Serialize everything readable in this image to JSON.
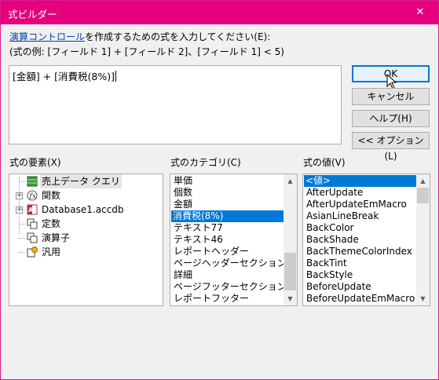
{
  "window": {
    "title": "式ビルダー",
    "close_glyph": "✕",
    "accent_color": "#e6007e"
  },
  "instruction": {
    "link_text": "演算コントロール",
    "rest_text": "を作成するための式を入力してください(E):",
    "example_text": "(式の例: [フィールド 1] + [フィールド 2]、[フィールド 1] < 5)"
  },
  "expression": {
    "value": "[金額] + [消費税(8%)]"
  },
  "buttons": {
    "ok": "OK",
    "cancel": "キャンセル",
    "help": "ヘルプ(H)",
    "options": "<< オプション(L)"
  },
  "elements_panel": {
    "label": "式の要素(X)",
    "items": [
      {
        "label": "売上データ クエリ",
        "icon": "query-icon",
        "expandable": false,
        "selected": true
      },
      {
        "label": "関数",
        "icon": "function-icon",
        "expandable": true,
        "selected": false
      },
      {
        "label": "Database1.accdb",
        "icon": "database-icon",
        "expandable": true,
        "selected": false
      },
      {
        "label": "定数",
        "icon": "constants-icon",
        "expandable": false,
        "selected": false
      },
      {
        "label": "演算子",
        "icon": "operators-icon",
        "expandable": false,
        "selected": false
      },
      {
        "label": "汎用",
        "icon": "common-expressions-icon",
        "expandable": false,
        "selected": false
      }
    ]
  },
  "categories_panel": {
    "label": "式のカテゴリ(C)",
    "items": [
      "単価",
      "個数",
      "金額",
      "消費税(8%)",
      "テキスト77",
      "テキスト46",
      "レポートヘッダー",
      "ページヘッダーセクション",
      "詳細",
      "ページフッターセクション",
      "レポートフッター"
    ],
    "selected_index": 3
  },
  "values_panel": {
    "label": "式の値(V)",
    "items": [
      "<値>",
      "AfterUpdate",
      "AfterUpdateEmMacro",
      "AsianLineBreak",
      "BackColor",
      "BackShade",
      "BackThemeColorIndex",
      "BackTint",
      "BackStyle",
      "BeforeUpdate",
      "BeforeUpdateEmMacro"
    ],
    "selected_index": 0
  }
}
